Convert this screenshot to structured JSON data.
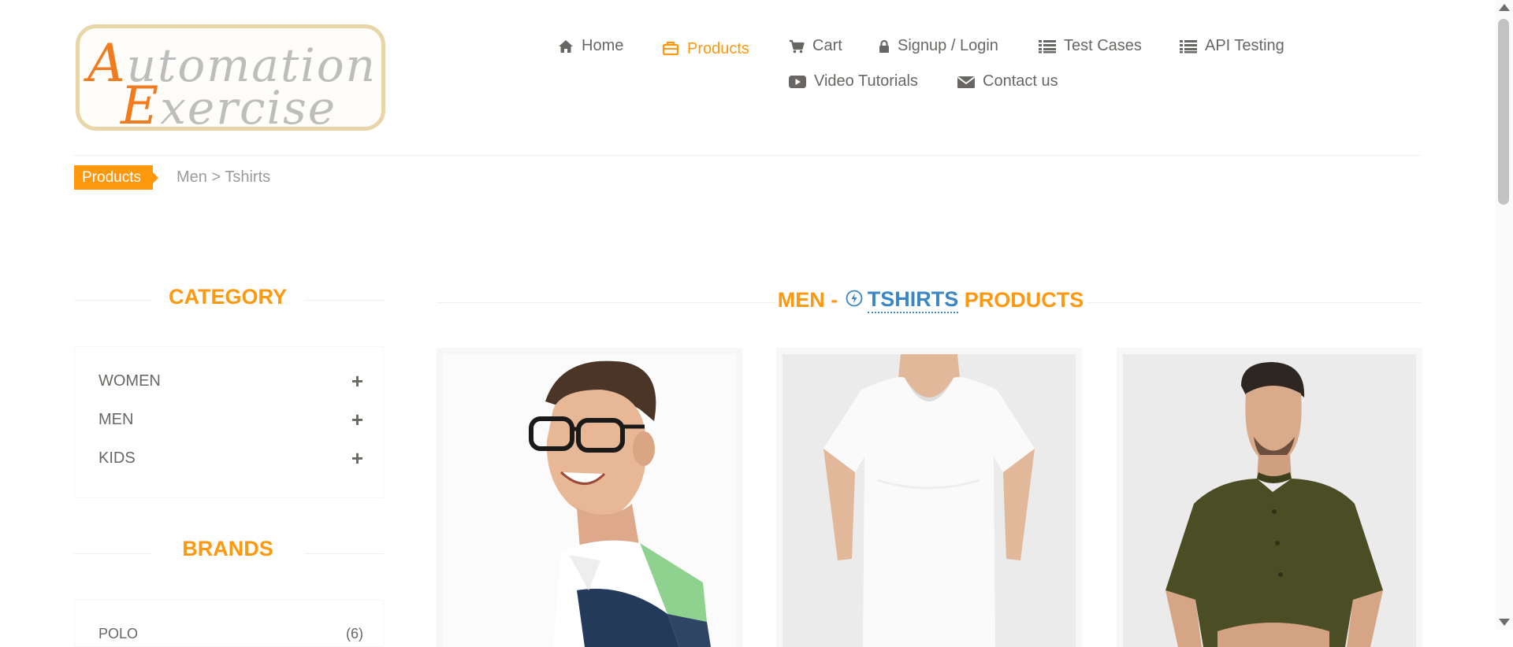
{
  "logo": {
    "line1_cap": "A",
    "line1_rest": "utomation",
    "line2_cap": "E",
    "line2_rest": "xercise"
  },
  "nav": {
    "items": [
      {
        "label": "Home",
        "icon": "home-icon"
      },
      {
        "label": "Products",
        "icon": "briefcase-icon",
        "active": true
      },
      {
        "label": "Cart",
        "icon": "cart-icon"
      },
      {
        "label": "Signup / Login",
        "icon": "lock-icon"
      },
      {
        "label": "Test Cases",
        "icon": "list-icon"
      },
      {
        "label": "API Testing",
        "icon": "list-icon"
      },
      {
        "label": "Video Tutorials",
        "icon": "youtube-play-icon"
      },
      {
        "label": "Contact us",
        "icon": "envelope-icon"
      }
    ]
  },
  "breadcrumb": {
    "tag": "Products",
    "path": "Men > Tshirts"
  },
  "sidebar": {
    "category_title": "CATEGORY",
    "categories": [
      {
        "label": "WOMEN",
        "toggle": "+"
      },
      {
        "label": "MEN",
        "toggle": "+"
      },
      {
        "label": "KIDS",
        "toggle": "+"
      }
    ],
    "brands_title": "BRANDS",
    "brands": [
      {
        "label": "POLO",
        "count": "(6)"
      }
    ]
  },
  "main": {
    "title_prefix": "MEN - ",
    "title_link": "TSHIRTS",
    "title_suffix": " PRODUCTS"
  },
  "colors": {
    "accent": "#fe980f",
    "text": "#696763",
    "link": "#3a87c8"
  }
}
